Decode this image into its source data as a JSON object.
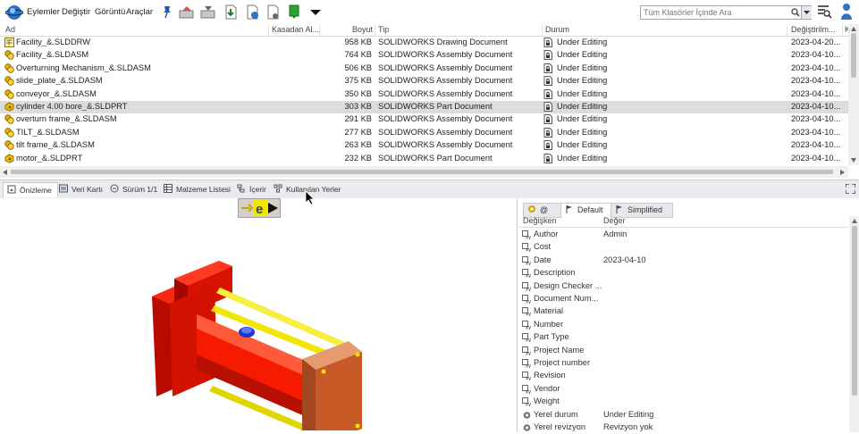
{
  "menu": {
    "actions": "Eylemler",
    "change": "Değiştir",
    "view": "Görüntü",
    "tools": "Araçlar"
  },
  "search": {
    "placeholder": "Tüm Klasörler İçinde Ara"
  },
  "columns": {
    "name": "Ad",
    "checkedout": "Kasadan Al...",
    "size": "Boyut",
    "type": "Tip",
    "state": "Durum",
    "modified": "Değiştirilm...",
    "extra": "K"
  },
  "files": [
    {
      "name": "Facility_&.SLDDRW",
      "size": "958 KB",
      "type": "SOLIDWORKS Drawing Document",
      "state": "Under Editing",
      "date": "2023-04-20...",
      "kind": "drw"
    },
    {
      "name": "Facility_&.SLDASM",
      "size": "764 KB",
      "type": "SOLIDWORKS Assembly Document",
      "state": "Under Editing",
      "date": "2023-04-10...",
      "kind": "asm"
    },
    {
      "name": "Overturning Mechanism_&.SLDASM",
      "size": "506 KB",
      "type": "SOLIDWORKS Assembly Document",
      "state": "Under Editing",
      "date": "2023-04-10...",
      "kind": "asm"
    },
    {
      "name": "slide_plate_&.SLDASM",
      "size": "375 KB",
      "type": "SOLIDWORKS Assembly Document",
      "state": "Under Editing",
      "date": "2023-04-10...",
      "kind": "asm"
    },
    {
      "name": "conveyor_&.SLDASM",
      "size": "350 KB",
      "type": "SOLIDWORKS Assembly Document",
      "state": "Under Editing",
      "date": "2023-04-10...",
      "kind": "asm"
    },
    {
      "name": "cylinder 4.00 bore_&.SLDPRT",
      "size": "303 KB",
      "type": "SOLIDWORKS Part Document",
      "state": "Under Editing",
      "date": "2023-04-10...",
      "kind": "prt",
      "selected": true
    },
    {
      "name": "overturn frame_&.SLDASM",
      "size": "291 KB",
      "type": "SOLIDWORKS Assembly Document",
      "state": "Under Editing",
      "date": "2023-04-10...",
      "kind": "asm"
    },
    {
      "name": "TILT_&.SLDASM",
      "size": "277 KB",
      "type": "SOLIDWORKS Assembly Document",
      "state": "Under Editing",
      "date": "2023-04-10...",
      "kind": "asm"
    },
    {
      "name": "tilt frame_&.SLDASM",
      "size": "263 KB",
      "type": "SOLIDWORKS Assembly Document",
      "state": "Under Editing",
      "date": "2023-04-10...",
      "kind": "asm"
    },
    {
      "name": "motor_&.SLDPRT",
      "size": "232 KB",
      "type": "SOLIDWORKS Part Document",
      "state": "Under Editing",
      "date": "2023-04-10...",
      "kind": "prt"
    }
  ],
  "bottom_tabs": {
    "preview": "Önizleme",
    "datacard": "Veri Kartı",
    "version": "Sürüm 1/1",
    "bom": "Malzeme Listesi",
    "contains": "İçerir",
    "whereused": "Kullanılan Yerler"
  },
  "props": {
    "tab_at": "@",
    "tab_default": "Default",
    "tab_simplified": "Simplified",
    "col_variable": "Değişken",
    "col_value": "Değer",
    "rows": [
      {
        "name": "Author",
        "value": "Admin"
      },
      {
        "name": "Cost",
        "value": ""
      },
      {
        "name": "Date",
        "value": "2023-04-10"
      },
      {
        "name": "Description",
        "value": ""
      },
      {
        "name": "Design Checker ...",
        "value": ""
      },
      {
        "name": "Document Num...",
        "value": ""
      },
      {
        "name": "Material",
        "value": ""
      },
      {
        "name": "Number",
        "value": ""
      },
      {
        "name": "Part Type",
        "value": ""
      },
      {
        "name": "Project Name",
        "value": ""
      },
      {
        "name": "Project number",
        "value": ""
      },
      {
        "name": "Revision",
        "value": ""
      },
      {
        "name": "Vendor",
        "value": ""
      },
      {
        "name": "Weight",
        "value": ""
      },
      {
        "name": "Yerel durum",
        "value": "Under Editing"
      },
      {
        "name": "Yerel revizyon",
        "value": "Revizyon yok"
      }
    ]
  },
  "colors": {
    "selected_row": "#dcdcdc",
    "part_red": "#e81000",
    "rod_yellow": "#f2e600"
  }
}
